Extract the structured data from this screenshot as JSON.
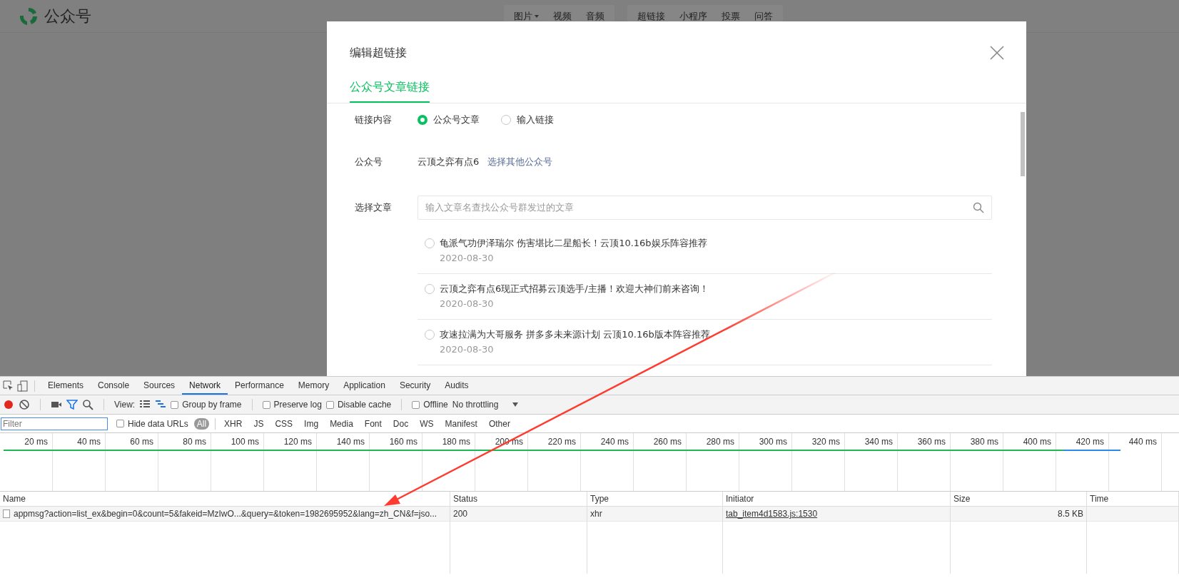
{
  "top_bar": {
    "logo_text": "公众号",
    "menu_groups": [
      [
        {
          "label": "图片",
          "kind": "dropdown"
        },
        {
          "label": "视频",
          "kind": "plain"
        },
        {
          "label": "音频",
          "kind": "plain"
        }
      ],
      [
        {
          "label": "超链接",
          "kind": "plain"
        },
        {
          "label": "小程序",
          "kind": "plain"
        },
        {
          "label": "投票",
          "kind": "plain"
        },
        {
          "label": "问答",
          "kind": "plain"
        }
      ]
    ]
  },
  "dialog": {
    "title": "编辑超链接",
    "tabs": [
      {
        "label": "公众号文章链接",
        "selected": true
      }
    ],
    "link_content": {
      "label": "链接内容",
      "options": [
        {
          "label": "公众号文章",
          "selected": true
        },
        {
          "label": "输入链接",
          "selected": false
        }
      ]
    },
    "account": {
      "label": "公众号",
      "value": "云顶之弈有点6",
      "link": "选择其他公众号"
    },
    "article": {
      "label": "选择文章",
      "placeholder": "输入文章名查找公众号群发过的文章"
    },
    "articles": [
      {
        "title": "龟派气功伊泽瑞尔 伤害堪比二星船长！云顶10.16b娱乐阵容推荐",
        "date": "2020-08-30",
        "selected": false
      },
      {
        "title": "云顶之弈有点6现正式招募云顶选手/主播！欢迎大神们前来咨询！",
        "date": "2020-08-30",
        "selected": false
      },
      {
        "title": "攻速拉满为大哥服务 拼多多未来源计划 云顶10.16b版本阵容推荐",
        "date": "2020-08-30",
        "selected": false
      }
    ]
  },
  "devtools": {
    "tabs": [
      {
        "label": "Elements",
        "selected": false
      },
      {
        "label": "Console",
        "selected": false
      },
      {
        "label": "Sources",
        "selected": false
      },
      {
        "label": "Network",
        "selected": true
      },
      {
        "label": "Performance",
        "selected": false
      },
      {
        "label": "Memory",
        "selected": false
      },
      {
        "label": "Application",
        "selected": false
      },
      {
        "label": "Security",
        "selected": false
      },
      {
        "label": "Audits",
        "selected": false
      }
    ],
    "toolbar": {
      "recording": true,
      "view_label": "View:",
      "view_modes": [
        {
          "kind": "list",
          "selected": false
        },
        {
          "kind": "waterfall",
          "selected": true
        }
      ],
      "options": [
        {
          "label": "Group by frame",
          "checked": false
        },
        {
          "label": "Preserve log",
          "checked": false
        },
        {
          "label": "Disable cache",
          "checked": false
        },
        {
          "label": "Offline",
          "checked": false
        }
      ],
      "throttling": "No throttling"
    },
    "filter": {
      "placeholder": "Filter",
      "hide_data_urls": {
        "label": "Hide data URLs",
        "checked": false
      },
      "types": [
        {
          "label": "All",
          "selected": true
        },
        {
          "label": "XHR",
          "selected": false
        },
        {
          "label": "JS",
          "selected": false
        },
        {
          "label": "CSS",
          "selected": false
        },
        {
          "label": "Img",
          "selected": false
        },
        {
          "label": "Media",
          "selected": false
        },
        {
          "label": "Font",
          "selected": false
        },
        {
          "label": "Doc",
          "selected": false
        },
        {
          "label": "WS",
          "selected": false
        },
        {
          "label": "Manifest",
          "selected": false
        },
        {
          "label": "Other",
          "selected": false
        }
      ]
    },
    "timeline_ticks": [
      "20 ms",
      "40 ms",
      "60 ms",
      "80 ms",
      "100 ms",
      "120 ms",
      "140 ms",
      "160 ms",
      "180 ms",
      "200 ms",
      "220 ms",
      "240 ms",
      "260 ms",
      "280 ms",
      "300 ms",
      "320 ms",
      "340 ms",
      "360 ms",
      "380 ms",
      "400 ms",
      "420 ms",
      "440 ms"
    ],
    "table": {
      "columns": [
        "Name",
        "Status",
        "Type",
        "Initiator",
        "Size",
        "Time"
      ],
      "rows": [
        {
          "cells": [
            "appmsg?action=list_ex&begin=0&count=5&fakeid=MzIwO...&query=&token=1982695952&lang=zh_CN&f=jso...",
            "200",
            "xhr",
            "tab_item4d1583.js:1530",
            "8.5 KB"
          ]
        }
      ]
    }
  }
}
